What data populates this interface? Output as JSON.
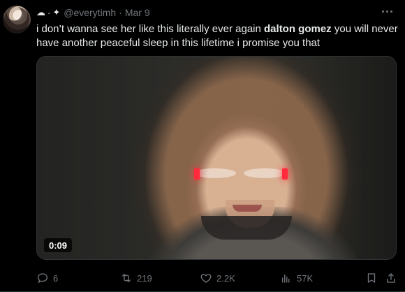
{
  "tweet": {
    "name_glyphs": [
      "☁",
      "·",
      "✦"
    ],
    "handle": "@everytimh",
    "separator": "·",
    "date": "Mar 9",
    "text_before": "i don’t wanna see her like this literally ever again ",
    "text_bold": "dalton gomez",
    "text_after": " you will never have another peaceful sleep in this lifetime i promise you that",
    "media": {
      "timestamp": "0:09"
    },
    "actions": {
      "replies": "6",
      "retweets": "219",
      "likes": "2.2K",
      "views": "57K"
    },
    "icons": {
      "more": "more-dots-icon",
      "reply": "reply-icon",
      "retweet": "retweet-icon",
      "like": "heart-icon",
      "views": "views-icon",
      "bookmark": "bookmark-icon",
      "share": "share-icon"
    },
    "colors": {
      "background": "#000000",
      "text": "#e7e9ea",
      "muted": "#71767b",
      "border": "#2f3336"
    }
  }
}
